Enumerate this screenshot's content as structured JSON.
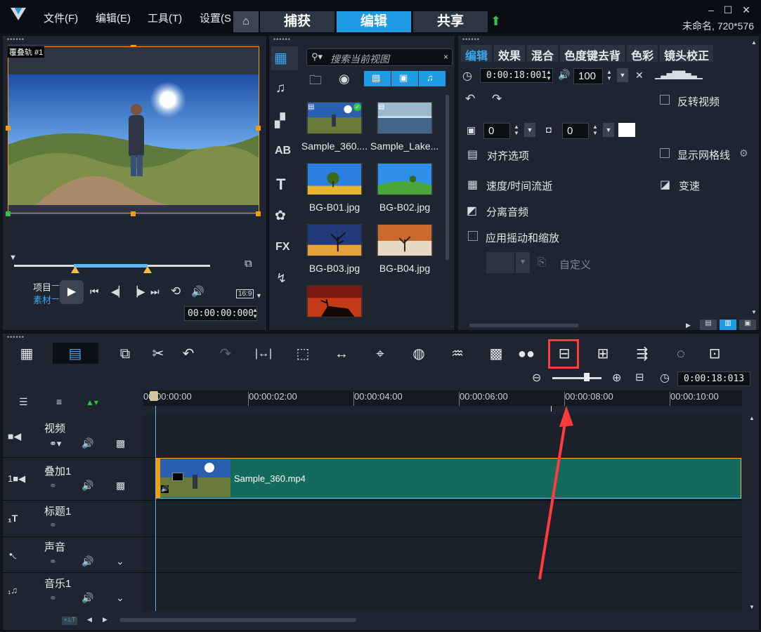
{
  "menu": {
    "file": "文件(F)",
    "edit": "编辑(E)",
    "tools": "工具(T)",
    "settings": "设置(S"
  },
  "tabs": {
    "capture": "捕获",
    "edit": "编辑",
    "share": "共享"
  },
  "window": {
    "project_info": "未命名, 720*576",
    "minimize": "–",
    "maximize": "☐",
    "close": "✕"
  },
  "preview": {
    "track_label": "覆叠轨 #1",
    "project_label": "项目",
    "clip_label": "素材",
    "timecode": "00:00:00:000",
    "aspect": "16:9"
  },
  "library": {
    "search_placeholder": "搜索当前视图",
    "items": [
      {
        "name": "Sample_360...."
      },
      {
        "name": "Sample_Lake...."
      },
      {
        "name": "BG-B01.jpg"
      },
      {
        "name": "BG-B02.jpg"
      },
      {
        "name": "BG-B03.jpg"
      },
      {
        "name": "BG-B04.jpg"
      },
      {
        "name": ""
      }
    ]
  },
  "options": {
    "tabs": [
      "编辑",
      "效果",
      "混合",
      "色度键去背",
      "色彩",
      "镜头校正"
    ],
    "duration": "0:00:18:001",
    "volume": "100",
    "reverse_video": "反转视频",
    "opacity_a": "0",
    "opacity_b": "0",
    "align_options": "对齐选项",
    "show_grid": "显示网格线",
    "speed_time": "速度/时间流逝",
    "variable_speed": "变速",
    "split_audio": "分离音频",
    "pan_zoom": "应用摇动和缩放",
    "customize": "自定义"
  },
  "timeline": {
    "zoom_timecode": "0:00:18:013",
    "ruler": [
      "00:00:00:00",
      "00:00:02:00",
      "00:00:04:00",
      "00:00:06:00",
      "00:00:08:00",
      "00:00:10:00"
    ],
    "tracks": [
      {
        "label": "视频"
      },
      {
        "label": "叠加1"
      },
      {
        "label": "标题1"
      },
      {
        "label": "声音"
      },
      {
        "label": "音乐1"
      }
    ],
    "clip_name": "Sample_360.mp4"
  },
  "colors": {
    "accent": "#1d9be4",
    "clip_fill": "#146b5b",
    "highlight": "#ff3b3b"
  }
}
